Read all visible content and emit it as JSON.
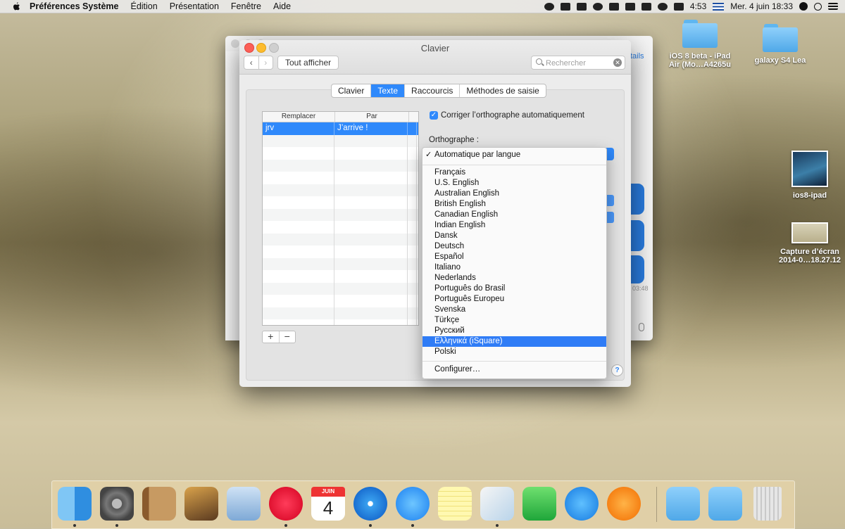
{
  "menubar": {
    "app": "Préférences Système",
    "items": [
      "Édition",
      "Présentation",
      "Fenêtre",
      "Aide"
    ],
    "battery_time": "4:53",
    "datetime": "Mer. 4 juin  18:33"
  },
  "desktop": {
    "icons": [
      {
        "label": "iOS 8 beta - iPad Air (Mo…A4265u"
      },
      {
        "label": "galaxy S4 Lea"
      },
      {
        "label": "ios8-ipad"
      },
      {
        "label": "Capture d’écran 2014-0…18.27.12"
      }
    ]
  },
  "back_window": {
    "link": "tails",
    "timestamp": "03:48"
  },
  "window": {
    "title": "Clavier",
    "show_all": "Tout afficher",
    "search_placeholder": "Rechercher",
    "tabs": [
      "Clavier",
      "Texte",
      "Raccourcis",
      "Méthodes de saisie"
    ],
    "active_tab": "Texte",
    "table": {
      "headers": [
        "Remplacer",
        "Par"
      ],
      "rows": [
        {
          "replace": "jrv",
          "with": "J’arrive !"
        }
      ]
    },
    "add_label": "+",
    "remove_label": "−",
    "autocorrect_label": "Corriger l’orthographe automatiquement",
    "autocorrect_checked": true,
    "spelling_label": "Orthographe :",
    "help_label": "?"
  },
  "spelling_menu": {
    "selected": "Automatique par langue",
    "languages": [
      "Français",
      "U.S. English",
      "Australian English",
      "British English",
      "Canadian English",
      "Indian English",
      "Dansk",
      "Deutsch",
      "Español",
      "Italiano",
      "Nederlands",
      "Português do Brasil",
      "Português Europeu",
      "Svenska",
      "Türkçe",
      "Русский",
      "Ελληνικά (iSquare)",
      "Polski"
    ],
    "highlighted": "Ελληνικά (iSquare)",
    "configure": "Configurer…"
  },
  "dock": {
    "calendar_month": "JUIN",
    "calendar_day": "4",
    "apps": [
      "finder-icon",
      "system-preferences-icon",
      "contacts-icon",
      "iphoto-icon",
      "mail-icon",
      "itunes-icon",
      "calendar-icon",
      "safari-icon",
      "messages-icon",
      "notes-icon",
      "preview-icon",
      "facetime-icon",
      "app-store-icon",
      "ibooks-icon",
      "downloads-folder-icon",
      "utilities-folder-icon",
      "trash-icon"
    ]
  },
  "colors": {
    "accent": "#2f89fb",
    "menu_highlight": "#2f7cf6",
    "close": "#fc5f57",
    "minimize": "#fdbc2e"
  }
}
